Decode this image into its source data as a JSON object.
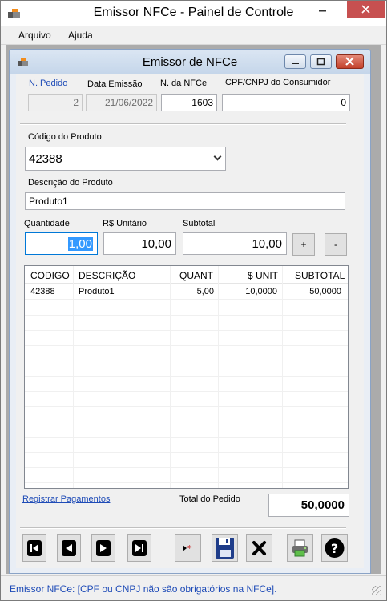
{
  "outer_window": {
    "title": "Emissor NFCe - Painel de Controle",
    "menu": [
      "Arquivo",
      "Ajuda"
    ]
  },
  "inner_window": {
    "title": "Emissor de NFCe"
  },
  "header": {
    "pedido_label": "N. Pedido",
    "pedido_value": "2",
    "data_label": "Data Emissão",
    "data_value": "21/06/2022",
    "nfce_label": "N. da NFCe",
    "nfce_value": "1603",
    "cpf_label": "CPF/CNPJ do Consumidor",
    "cpf_value": "0"
  },
  "produto": {
    "codigo_label": "Código do Produto",
    "codigo_value": "42388",
    "descricao_label": "Descrição do Produto",
    "descricao_value": "Produto1"
  },
  "valores": {
    "quantidade_label": "Quantidade",
    "quantidade_value": "1,00",
    "unitario_label": "R$ Unitário",
    "unitario_value": "10,00",
    "subtotal_label": "Subtotal",
    "subtotal_value": "10,00",
    "plus_label": "+",
    "minus_label": "-"
  },
  "grid": {
    "columns": [
      "CODIGO",
      "DESCRIÇÃO",
      "QUANT",
      "$ UNIT",
      "SUBTOTAL"
    ],
    "rows": [
      {
        "codigo": "42388",
        "descricao": "Produto1",
        "quant": "5,00",
        "unit": "10,0000",
        "subtotal": "50,0000"
      }
    ]
  },
  "footer": {
    "registrar_link": "Registrar Pagamentos",
    "total_label": "Total do Pedido",
    "total_value": "50,0000"
  },
  "toolbar": {
    "icons": [
      "first-icon",
      "previous-icon",
      "next-icon",
      "last-icon",
      "new-item-icon",
      "save-icon",
      "cancel-icon",
      "print-icon",
      "help-icon"
    ],
    "new_glyph": "▸*",
    "help_glyph": "?"
  },
  "status": {
    "text": "Emissor NFCe: [CPF ou CNPJ não são obrigatórios na NFCe]."
  },
  "colors": {
    "accent_blue": "#1e4bb7",
    "selection": "#3399ff"
  }
}
